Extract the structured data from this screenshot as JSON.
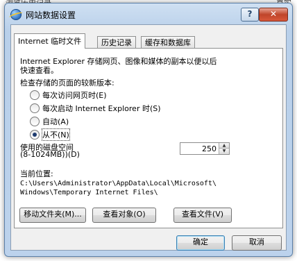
{
  "background": {
    "top_left_text": "浏览历史记录",
    "top_right_text": "真实"
  },
  "window": {
    "title": "网站数据设置",
    "help_label": "?",
    "close_label": "✕"
  },
  "tabs": [
    {
      "label": "Internet 临时文件"
    },
    {
      "label": "历史记录"
    },
    {
      "label": "缓存和数据库"
    }
  ],
  "panel": {
    "description_line1": "Internet Explorer 存储网页、图像和媒体的副本以便以后",
    "description_line2": "快速查看。",
    "check_label": "检查存储的页面的较新版本:",
    "options": [
      {
        "label": "每次访问网页时(E)",
        "checked": false
      },
      {
        "label": "每次启动 Internet Explorer 时(S)",
        "checked": false
      },
      {
        "label": "自动(A)",
        "checked": false
      },
      {
        "label": "从不(N)",
        "checked": true
      }
    ],
    "disk_label_line1": "使用的磁盘空间",
    "disk_label_line2": "(8-1024MB))(D)",
    "disk_value": "250",
    "location_label": "当前位置:",
    "location_path_line1": "C:\\Users\\Administrator\\AppData\\Local\\Microsoft\\",
    "location_path_line2": "Windows\\Temporary Internet Files\\",
    "buttons": {
      "move_folder": "移动文件夹(M)...",
      "view_objects": "查看对象(O)",
      "view_files": "查看文件(V)"
    }
  },
  "dialog_buttons": {
    "ok": "确定",
    "cancel": "取消"
  }
}
